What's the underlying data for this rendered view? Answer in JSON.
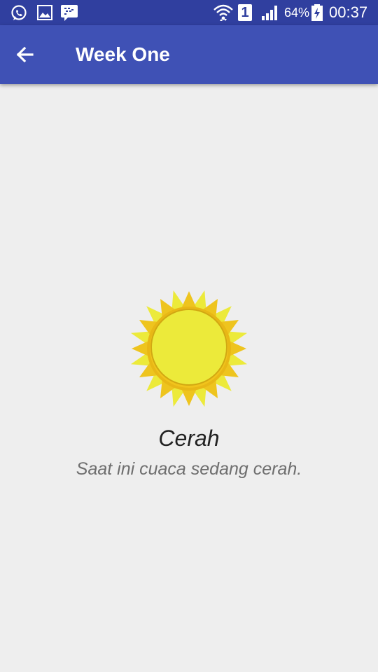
{
  "status_bar": {
    "battery": "64%",
    "time": "00:37",
    "sim_slot": "1",
    "icons": [
      "whatsapp-icon",
      "gallery-icon",
      "bbm-icon",
      "wifi-icon",
      "sim-icon",
      "signal-icon",
      "battery-charging-icon"
    ]
  },
  "app_bar": {
    "title": "Week One",
    "back_icon": "arrow-left-icon"
  },
  "weather": {
    "icon": "sun-icon",
    "title": "Cerah",
    "description": "Saat ini cuaca sedang cerah."
  },
  "colors": {
    "status_bar": "#303f9f",
    "app_bar": "#3f51b5",
    "background": "#eeeeee",
    "sun_outer": "#f0c419",
    "sun_inner": "#ecea3a"
  }
}
